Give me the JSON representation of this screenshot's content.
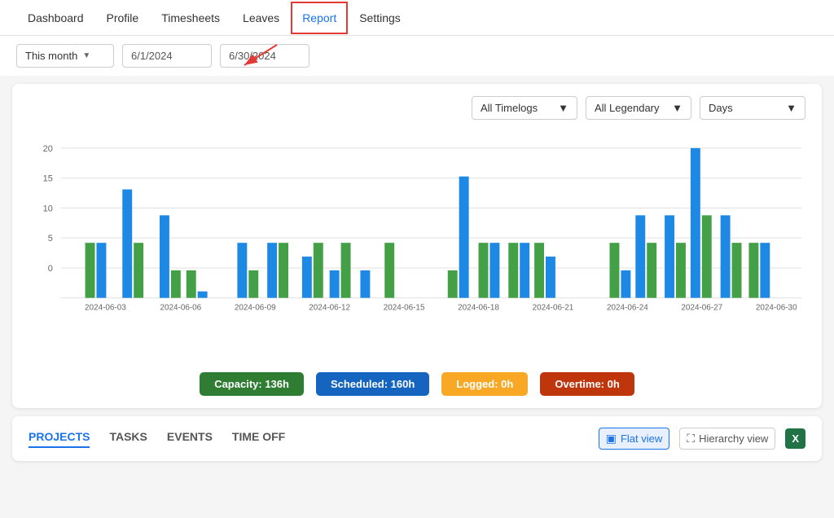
{
  "nav": {
    "items": [
      {
        "label": "Dashboard",
        "active": false
      },
      {
        "label": "Profile",
        "active": false
      },
      {
        "label": "Timesheets",
        "active": false
      },
      {
        "label": "Leaves",
        "active": false
      },
      {
        "label": "Report",
        "active": true
      },
      {
        "label": "Settings",
        "active": false
      }
    ]
  },
  "toolbar": {
    "period_label": "This month",
    "start_date": "6/1/2024",
    "end_date": "6/30/2024"
  },
  "filters": {
    "timelogs_label": "All Timelogs",
    "legendary_label": "All Legendary",
    "period_label": "Days"
  },
  "chart": {
    "y_labels": [
      "20",
      "15",
      "10",
      "5",
      "0"
    ],
    "x_labels": [
      "2024-06-03",
      "2024-06-06",
      "2024-06-09",
      "2024-06-12",
      "2024-06-15",
      "2024-06-18",
      "2024-06-21",
      "2024-06-24",
      "2024-06-27",
      "2024-06-30"
    ]
  },
  "legend": [
    {
      "label": "Capacity: 136h",
      "color": "#2e7d32"
    },
    {
      "label": "Scheduled: 160h",
      "color": "#1565c0"
    },
    {
      "label": "Logged: 0h",
      "color": "#f9a825"
    },
    {
      "label": "Overtime: 0h",
      "color": "#bf360c"
    }
  ],
  "tabs": [
    {
      "label": "PROJECTS",
      "active": true
    },
    {
      "label": "TASKS",
      "active": false
    },
    {
      "label": "EVENTS",
      "active": false
    },
    {
      "label": "TIME OFF",
      "active": false
    }
  ],
  "view": {
    "flat_label": "Flat view",
    "hierarchy_label": "Hierarchy view",
    "excel_label": "X"
  }
}
